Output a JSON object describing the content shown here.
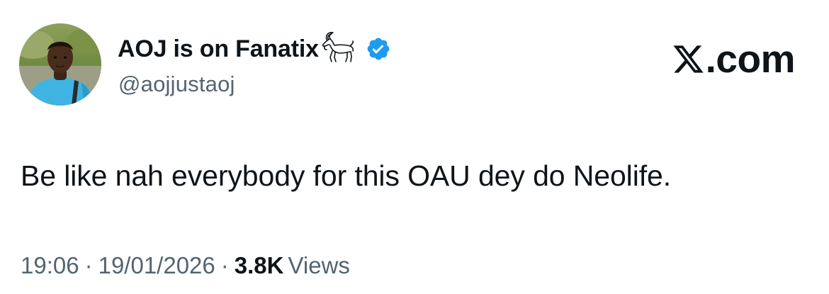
{
  "author": {
    "display_name": "AOJ is on Fanatix",
    "handle": "@aojjustaoj",
    "badge_icon": "goat-icon",
    "verified_icon": "verified-badge-icon",
    "verified_color": "#1d9bf0"
  },
  "brand": {
    "logo_icon": "x-logo-icon",
    "domain_suffix": ".com"
  },
  "tweet": {
    "text": "Be like nah everybody for this OAU dey do Neolife."
  },
  "meta": {
    "time": "19:06",
    "separator": "·",
    "date": "19/01/2026",
    "views_count": "3.8K",
    "views_label": "Views"
  },
  "colors": {
    "text_primary": "#0f1419",
    "text_secondary": "#536471",
    "accent": "#1d9bf0",
    "background": "#ffffff"
  }
}
